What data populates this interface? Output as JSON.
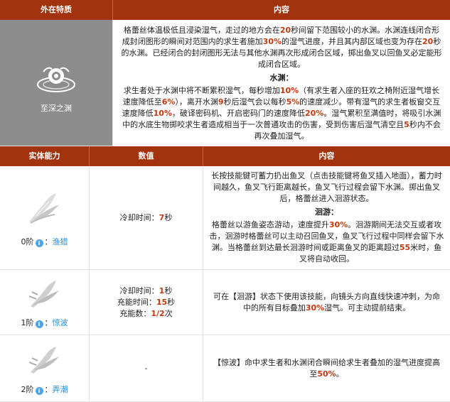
{
  "header1": {
    "col1": "外在特质",
    "col2": "内容"
  },
  "trait": {
    "name": "至深之渊",
    "p1": [
      {
        "t": "格蕾丝体温极低且浸染湿气，走过的地方会在"
      },
      {
        "t": "20",
        "c": "red"
      },
      {
        "t": "秒间留下范围较小的水渊。水渊连线闭合形成封闭图形的瞬间对范围内的求生者施加"
      },
      {
        "t": "30%",
        "c": "red"
      },
      {
        "t": "的湿气进度，并且其内部区域也变为存在"
      },
      {
        "t": "20",
        "c": "red"
      },
      {
        "t": "秒的水渊。已经闭合的封闭图形无法与其他水渊再次形成闭合区域，掷出鱼叉以回鱼叉必定能形成闭合区域。"
      }
    ],
    "sub_title": "水渊：",
    "p2": [
      {
        "t": "求生者处于水渊中将不断累积湿气，每秒增加"
      },
      {
        "t": "10%",
        "c": "red"
      },
      {
        "t": "（有求生者入座的狂欢之椅附近湿气增长速度降低至"
      },
      {
        "t": "6%",
        "c": "red"
      },
      {
        "t": "），离开水渊"
      },
      {
        "t": "9",
        "c": "red"
      },
      {
        "t": "秒后湿气会以每秒"
      },
      {
        "t": "5%",
        "c": "red"
      },
      {
        "t": "的速度减少。带有湿气的求生者板窗交互速度降低"
      },
      {
        "t": "10%",
        "c": "red"
      },
      {
        "t": "，破译密码机、开启密码门的速度降低"
      },
      {
        "t": "20%",
        "c": "red"
      },
      {
        "t": "。湿气累积至满值时，将吸引水渊中的水底生物掷咬求生者造成相当于一次普通攻击的伤害，受到伤害后湿气清空且"
      },
      {
        "t": "5",
        "c": "red"
      },
      {
        "t": "秒内不会再次叠加湿气。"
      }
    ]
  },
  "header2": {
    "col1": "实体能力",
    "col2": "数值",
    "col3": "内容"
  },
  "abilities": [
    {
      "level": "0阶",
      "name": "渔猎",
      "values": [
        [
          {
            "t": "冷却时间："
          },
          {
            "t": "7",
            "c": "red"
          },
          {
            "t": "秒"
          }
        ]
      ],
      "content_p1": [
        {
          "t": "长按技能键可蓄力扔出鱼叉（点击技能键将鱼叉插入地面），蓄力时间越久，鱼叉飞行距离越长，鱼叉飞行过程会留下水渊。掷出鱼叉后，格蕾丝进入洄游状态。"
        }
      ],
      "content_sub": "洄游：",
      "content_p2": [
        {
          "t": "格蕾丝以游鱼姿态游动，速度提升"
        },
        {
          "t": "30%",
          "c": "red"
        },
        {
          "t": "。洄游期间无法交互或者攻击，洄游时格蕾丝可以主动召回鱼叉，鱼叉飞行过程中同样会留下水渊。当格蕾丝到达最长洄游时间或距离鱼叉的距离超过"
        },
        {
          "t": "55",
          "c": "red"
        },
        {
          "t": "米时，鱼叉将自动收回。"
        }
      ]
    },
    {
      "level": "1阶",
      "name": "惊波",
      "values": [
        [
          {
            "t": "冷却时间："
          },
          {
            "t": "1",
            "c": "red"
          },
          {
            "t": "秒"
          }
        ],
        [
          {
            "t": "充能时间："
          },
          {
            "t": "15",
            "c": "red"
          },
          {
            "t": "秒"
          }
        ],
        [
          {
            "t": "充能数："
          },
          {
            "t": "1/2",
            "c": "red"
          },
          {
            "t": "次"
          }
        ]
      ],
      "content_p1": [
        {
          "t": "可在【洄游】状态下使用该技能，向镜头方向直线快速冲刺，为命中的所有目标叠加"
        },
        {
          "t": "30%",
          "c": "red"
        },
        {
          "t": "湿气。可主动提前结束。"
        }
      ]
    },
    {
      "level": "2阶",
      "name": "弄潮",
      "values_text": "-",
      "content_p1": [
        {
          "t": "【惊波】命中求生者和水渊闭合瞬间给求生者叠加的湿气进度提高至"
        },
        {
          "t": "50%",
          "c": "red"
        },
        {
          "t": "。"
        }
      ]
    }
  ],
  "colors": {
    "header_bg": "#a3320f",
    "highlight": "#c4380e",
    "trait_bg": "#8c8c8c",
    "link": "#2b8fd8"
  },
  "icons": {
    "info": "info-icon",
    "trait": "abyss-eye-icon",
    "skill": "wing-splash-icon"
  }
}
